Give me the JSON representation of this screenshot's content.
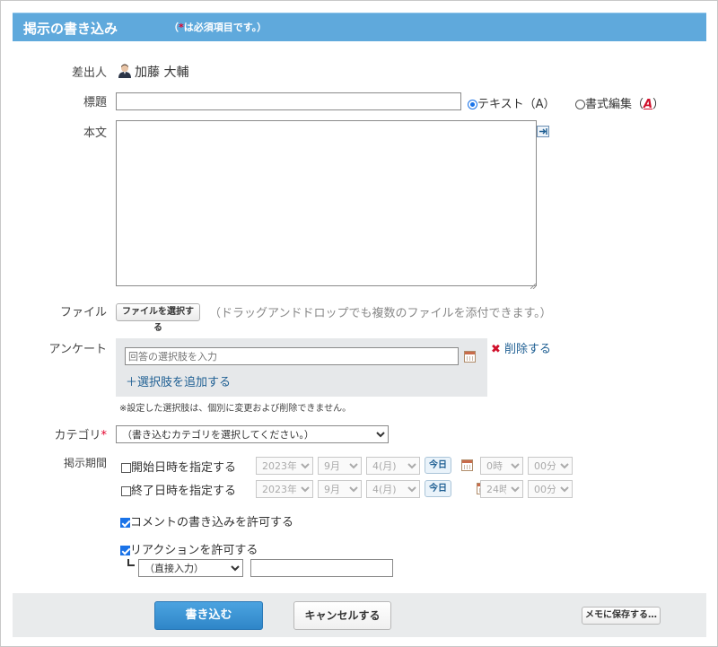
{
  "header": {
    "title": "掲示の書き込み",
    "note_prefix": "（",
    "note_star": "*",
    "note_text": "は必須項目です。）"
  },
  "sender": {
    "label": "差出人",
    "name": "加藤 大輔"
  },
  "subject": {
    "label": "標題",
    "value": "",
    "option_text": "テキスト（A）",
    "option_rich": "書式編集（",
    "option_rich_icon": "A",
    "option_rich_close": "）"
  },
  "body": {
    "label": "本文",
    "value": ""
  },
  "file": {
    "label": "ファイル",
    "button": "ファイルを選択する",
    "hint": "（ドラッグアンドドロップでも複数のファイルを添付できます。）"
  },
  "survey": {
    "label": "アンケート",
    "choice_placeholder": "回答の選択肢を入力",
    "delete": "削除する",
    "add_choice": "＋選択肢を追加する",
    "note": "※設定した選択肢は、個別に変更および削除できません。"
  },
  "category": {
    "label": "カテゴリ",
    "required_mark": "*",
    "selected": "（書き込むカテゴリを選択してください。）"
  },
  "period": {
    "label": "掲示期間",
    "start": {
      "label": "開始日時を指定する",
      "year": "2023年",
      "month": "9月",
      "day": "4(月)",
      "today": "今日",
      "hour": "0時",
      "minute": "00分"
    },
    "end": {
      "label": "終了日時を指定する",
      "year": "2023年",
      "month": "9月",
      "day": "4(月)",
      "today": "今日",
      "hour": "24時",
      "minute": "00分"
    }
  },
  "options": {
    "allow_comments": "コメントの書き込みを許可する",
    "allow_comments_checked": true,
    "allow_reactions": "リアクションを許可する",
    "allow_reactions_checked": true,
    "reaction_mode": "（直接入力）",
    "reaction_value": ""
  },
  "footer": {
    "submit": "書き込む",
    "cancel": "キャンセルする",
    "save_memo": "メモに保存する…"
  },
  "colors": {
    "header_bg": "#5fa9dc",
    "primary_button": "#3a93d4",
    "link": "#1f5f93",
    "required": "#e4002b"
  }
}
